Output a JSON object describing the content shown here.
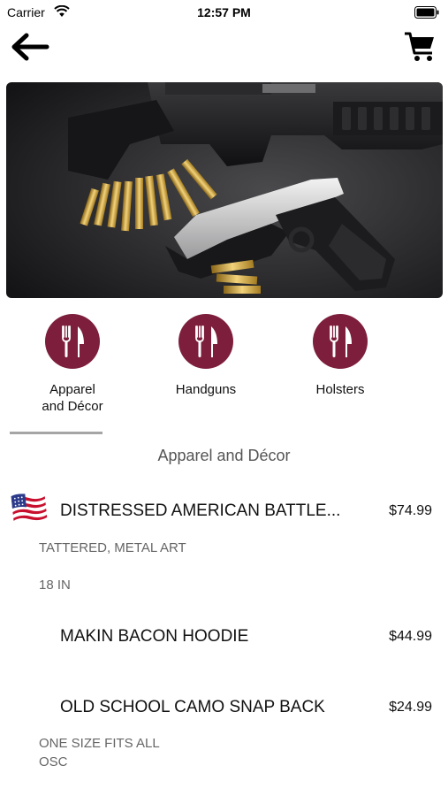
{
  "status_bar": {
    "carrier": "Carrier",
    "time": "12:57 PM"
  },
  "nav": {
    "back_icon": "arrow-left-icon",
    "cart_icon": "cart-icon"
  },
  "hero": {
    "image": "handgun-rifle-ammunition-photo"
  },
  "categories": [
    {
      "line1": "Apparel",
      "line2": "and Décor",
      "icon": "fork-knife-icon",
      "selected": true
    },
    {
      "line1": "Handguns",
      "line2": "",
      "icon": "fork-knife-icon",
      "selected": false
    },
    {
      "line1": "Holsters",
      "line2": "",
      "icon": "fork-knife-icon",
      "selected": false
    }
  ],
  "colors": {
    "category_icon": "#7d1f3c",
    "underline": "#a5a5a5"
  },
  "section": {
    "title": "Apparel and Décor"
  },
  "items": [
    {
      "name": "DISTRESSED AMERICAN BATTLE...",
      "price": "$74.99",
      "thumb": "american-flag-icon",
      "desc1": "TATTERED, METAL ART",
      "desc2": "18 IN"
    },
    {
      "name": "MAKIN BACON HOODIE",
      "price": "$44.99"
    },
    {
      "name": "OLD SCHOOL CAMO SNAP BACK",
      "price": "$24.99",
      "desc1": "ONE SIZE FITS ALL",
      "desc2": "OSC"
    }
  ]
}
